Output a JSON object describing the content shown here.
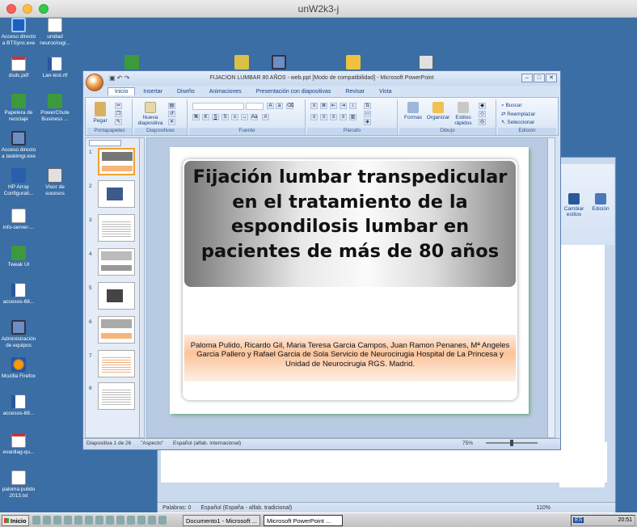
{
  "mac_window": {
    "title": "unW2k3-j"
  },
  "desktop_icons": [
    {
      "label": "Acceso directo a BTSync.exe",
      "icon": "sync-icon"
    },
    {
      "label": "unidad neurocirugi...",
      "icon": "document-icon"
    },
    {
      "label": "dsds.pdf",
      "icon": "pdf-icon"
    },
    {
      "label": "Lan-test.rtf",
      "icon": "word-doc-icon"
    },
    {
      "label": "Papelera de reciclaje",
      "icon": "recycle-bin-icon"
    },
    {
      "label": "PowerChute Business ...",
      "icon": "powerchute-icon"
    },
    {
      "label": "Acceso directo a tasklmgr.exe",
      "icon": "task-manager-icon"
    },
    {
      "label": "HP Array Configurati...",
      "icon": "hp-array-icon"
    },
    {
      "label": "Visor de sucesos",
      "icon": "event-viewer-icon"
    },
    {
      "label": "info-server-...",
      "icon": "document-icon"
    },
    {
      "label": "Tweak UI",
      "icon": "tweakui-icon"
    },
    {
      "label": "accesos-68...",
      "icon": "word-doc-icon"
    },
    {
      "label": "Administración de equipos",
      "icon": "computer-management-icon"
    },
    {
      "label": "Mozilla Firefox",
      "icon": "firefox-icon"
    },
    {
      "label": "accesos-68...",
      "icon": "word-doc-icon"
    },
    {
      "label": "evanllag-qu...",
      "icon": "pdf-icon"
    },
    {
      "label": "paloma pulido 2013.txt",
      "icon": "text-file-icon"
    }
  ],
  "ppt": {
    "title": "FIJACION LUMBAR 80 AÑOS - web.ppt [Modo de compatibilidad] - Microsoft PowerPoint",
    "tabs": [
      "Inicio",
      "Insertar",
      "Diseño",
      "Animaciones",
      "Presentación con diapositivas",
      "Revisar",
      "Vista"
    ],
    "groups": {
      "portapapeles": "Portapapeles",
      "diapositivas": "Diapositivas",
      "fuente": "Fuente",
      "parrafo": "Párrafo",
      "dibujo": "Dibujo",
      "edicion": "Edición"
    },
    "buttons": {
      "pegar": "Pegar",
      "nueva_diapositiva": "Nueva diapositiva",
      "formas": "Formas",
      "organizar": "Organizar",
      "estilos_rapidos": "Estilos rápidos",
      "buscar": "Buscar",
      "reemplazar": "Reemplazar",
      "seleccionar": "Seleccionar"
    },
    "thumb_numbers": [
      "1",
      "2",
      "3",
      "4",
      "5",
      "6",
      "7",
      "8"
    ],
    "slide": {
      "title": "Fijación lumbar transpedicular en el tratamiento de la espondilosis lumbar en pacientes de más de 80 años",
      "authors": "Paloma Pulido, Ricardo Gil, Maria Teresa Garcia Campos, Juan Ramon Penanes, Mª Angeles Garcia Pallero y Rafael Garcia de Sola",
      "affiliation": "Servicio de Neurocirugia Hospital de La Princesa y Unidad de Neurocirugia RGS. Madrid."
    },
    "status": {
      "slide_info": "Diapositiva 1 de 26",
      "theme": "\"Aspecto\"",
      "language": "Español (alfab. internacional)",
      "zoom": "75%"
    }
  },
  "word": {
    "ribbon": {
      "cambiar_estilos": "Cambiar estilos",
      "edicion": "Edición"
    },
    "status": {
      "words": "Palabras: 0",
      "language": "Español (España - alfab. tradicional)",
      "zoom": "110%"
    }
  },
  "taskbar": {
    "start": "Inicio",
    "items": [
      "Documento1 - Microsoft ...",
      "Microsoft PowerPoint ..."
    ],
    "lang": "ES",
    "clock": "20:51"
  }
}
